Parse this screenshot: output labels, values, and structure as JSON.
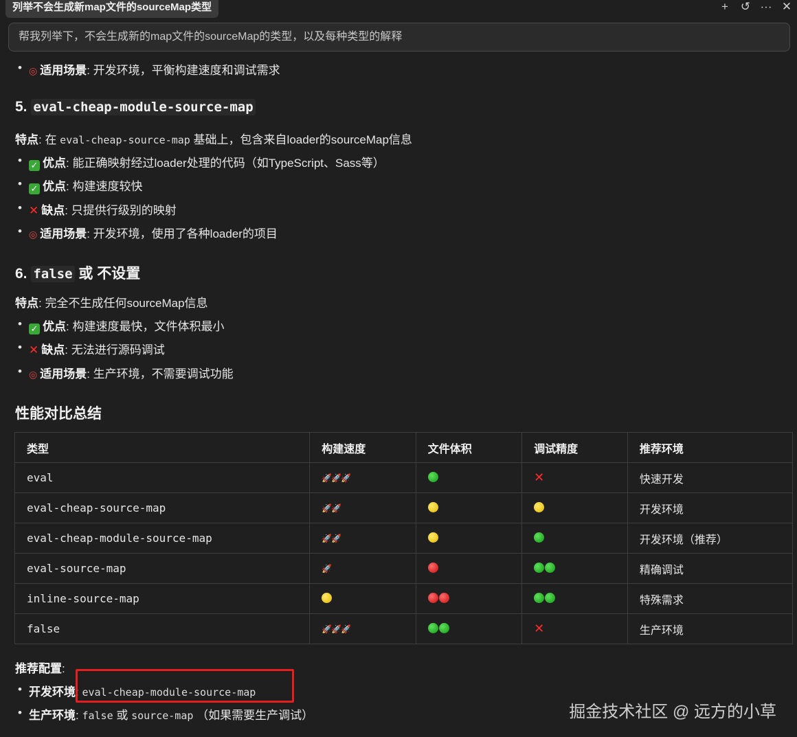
{
  "tab_title": "列举不会生成新map文件的sourceMap类型",
  "toolbar_icons": [
    "plus-icon",
    "history-icon",
    "more-icon",
    "close-icon"
  ],
  "toolbar_glyphs": {
    "plus": "+",
    "history": "↺",
    "more": "···",
    "close": "✕"
  },
  "prompt": "帮我列举下，不会生成新的map文件的sourceMap的类型，以及每种类型的解释",
  "intro_bullet": {
    "label": "适用场景",
    "text": ": 开发环境，平衡构建速度和调试需求"
  },
  "sec5": {
    "num": "5.",
    "title": "eval-cheap-module-source-map",
    "feature_label": "特点",
    "feature_pre": ": 在 ",
    "feature_code": "eval-cheap-source-map",
    "feature_post": " 基础上，包含来自loader的sourceMap信息",
    "bullets": [
      {
        "kind": "pro",
        "label": "优点",
        "text": ": 能正确映射经过loader处理的代码（如TypeScript、Sass等）"
      },
      {
        "kind": "pro",
        "label": "优点",
        "text": ": 构建速度较快"
      },
      {
        "kind": "con",
        "label": "缺点",
        "text": ": 只提供行级别的映射"
      },
      {
        "kind": "use",
        "label": "适用场景",
        "text": ": 开发环境，使用了各种loader的项目"
      }
    ]
  },
  "sec6": {
    "num": "6.",
    "title_code": "false",
    "title_rest": " 或 不设置",
    "feature_label": "特点",
    "feature_text": ": 完全不生成任何sourceMap信息",
    "bullets": [
      {
        "kind": "pro",
        "label": "优点",
        "text": ": 构建速度最快，文件体积最小"
      },
      {
        "kind": "con",
        "label": "缺点",
        "text": ": 无法进行源码调试"
      },
      {
        "kind": "use",
        "label": "适用场景",
        "text": ": 生产环境，不需要调试功能"
      }
    ]
  },
  "summary_title": "性能对比总结",
  "table": {
    "headers": [
      "类型",
      "构建速度",
      "文件体积",
      "调试精度",
      "推荐环境"
    ],
    "rows": [
      {
        "type": "eval",
        "speed": 3,
        "size": [
          "g"
        ],
        "precision": [
          "x"
        ],
        "env": "快速开发"
      },
      {
        "type": "eval-cheap-source-map",
        "speed": 2,
        "size": [
          "y"
        ],
        "precision": [
          "y"
        ],
        "env": "开发环境"
      },
      {
        "type": "eval-cheap-module-source-map",
        "speed": 2,
        "size": [
          "y"
        ],
        "precision": [
          "g"
        ],
        "env": "开发环境（推荐）"
      },
      {
        "type": "eval-source-map",
        "speed": 1,
        "size": [
          "r"
        ],
        "precision": [
          "g",
          "g"
        ],
        "env": "精确调试"
      },
      {
        "type": "inline-source-map",
        "speed": "y",
        "size": [
          "r",
          "r"
        ],
        "precision": [
          "g",
          "g"
        ],
        "env": "特殊需求"
      },
      {
        "type": "false",
        "speed": 3,
        "size": [
          "g",
          "g"
        ],
        "precision": [
          "x"
        ],
        "env": "生产环境"
      }
    ]
  },
  "recommend": {
    "title": "推荐配置",
    "colon": ":",
    "dev_label": "开发环境",
    "dev_code": "eval-cheap-module-source-map",
    "prod_label": "生产环境",
    "prod_code1": "false",
    "prod_or": " 或 ",
    "prod_code2": "source-map",
    "prod_note": " （如果需要生产调试）"
  },
  "watermark": "掘金技术社区 @ 远方的小草",
  "symbols": {
    "bullet": "•",
    "check": "✓",
    "cross": "✕",
    "dart": "◎",
    "rocket": "🚀"
  }
}
